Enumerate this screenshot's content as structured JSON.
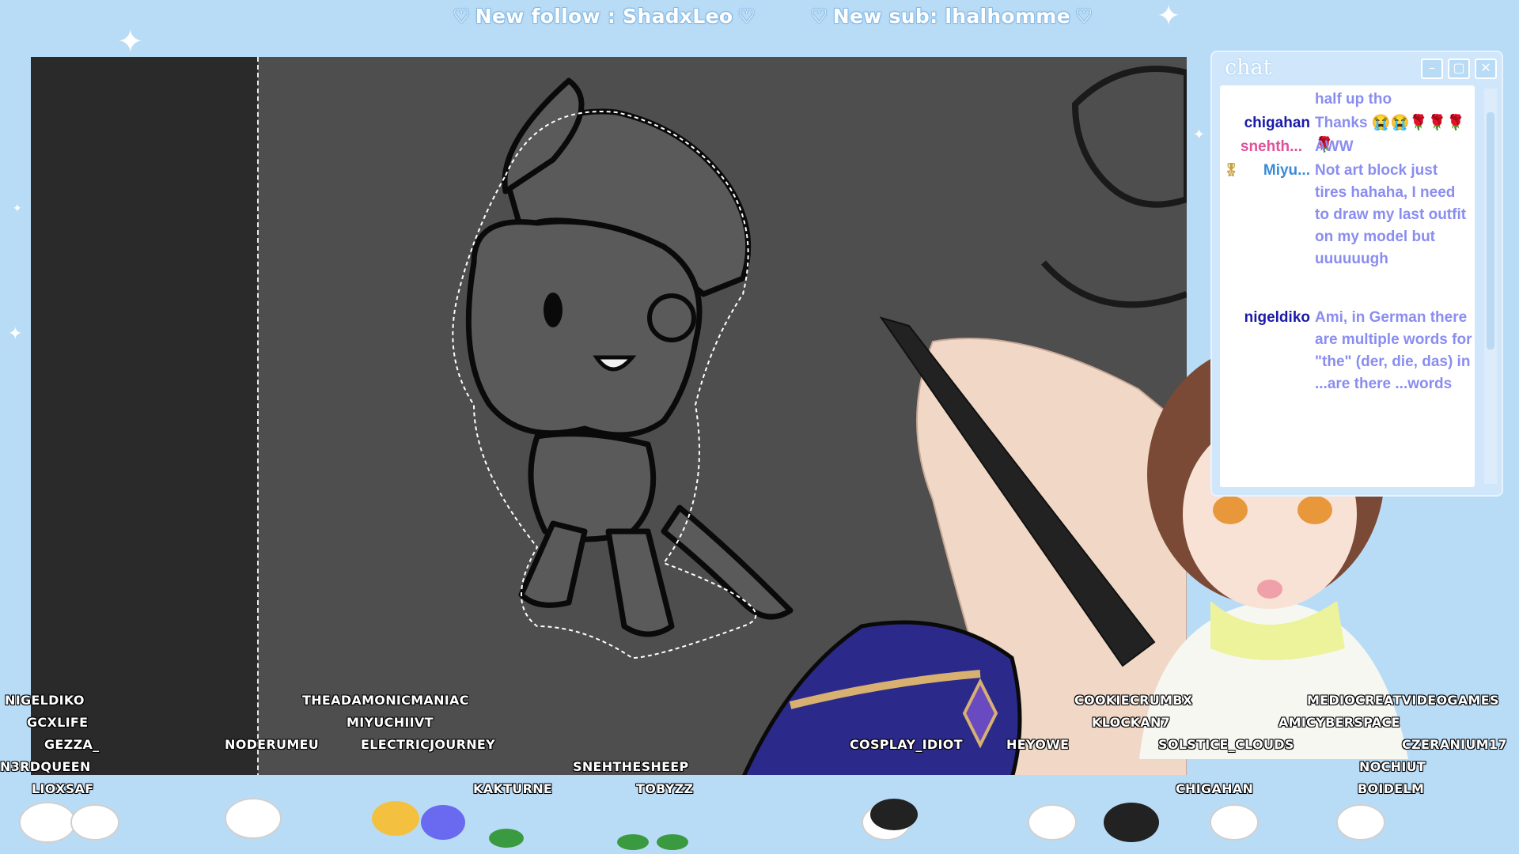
{
  "alerts": {
    "follow": "New follow : ShadxLeo",
    "sub": "New sub: lhalhomme",
    "heart": "♡"
  },
  "chat": {
    "title": "chat",
    "messages": [
      {
        "user": "",
        "text": "half up tho",
        "user_color": "#1a1aa8"
      },
      {
        "user": "chigahan",
        "text": "Thanks 😭😭🌹🌹🌹🌹",
        "user_color": "#1a1aa8"
      },
      {
        "user": "snehth...",
        "text": "AWW",
        "user_color": "#e0509a"
      },
      {
        "user": "Miyu...",
        "text": "Not art block just tires hahaha, I need to draw my last outfit on my model but uuuuuugh",
        "user_color": "#3a8ad8"
      },
      {
        "user": "nigeldiko",
        "text": "Ami, in German there are multiple words for \"the\" (der, die, das) in ...are there ...words",
        "user_color": "#1a1aa8"
      }
    ]
  },
  "viewers": [
    "NIGELDIKO",
    "GCXLIFE",
    "GEZZA_",
    "N3RDQUEEN",
    "LIOXSAF",
    "THEADAMONICMANIAC",
    "MIYUCHIIVT",
    "NODERUMEU",
    "ELECTRICJOURNEY",
    "SNEHTHESHEEP",
    "KAKTURNE",
    "TOBYZZ",
    "COSPLAY_IDIOT",
    "HEYOWE",
    "COOKIECRUMBX",
    "KLOCKAN7",
    "SOLSTICE_CLOUDS",
    "CHIGAHAN",
    "MEDIOCREATVIDEOGAMES",
    "AMICYBERSPACE",
    "CZERANIUM17",
    "NOCHIUT",
    "BOIDELM"
  ],
  "colors": {
    "background": "#b9dcf6",
    "canvas": "#4e4e4e",
    "panel": "#2a2a2a",
    "chat_text": "#8a8df0"
  }
}
